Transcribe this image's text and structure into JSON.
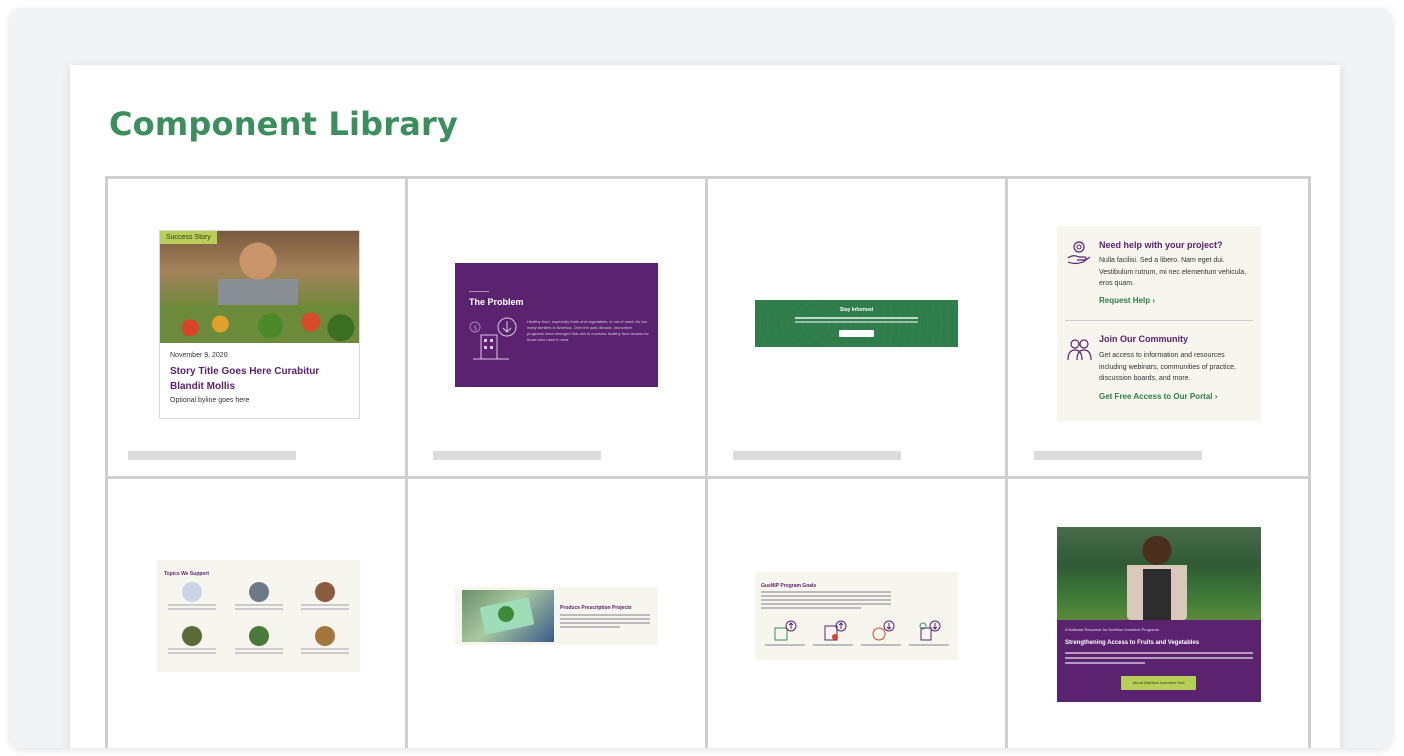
{
  "page": {
    "title": "Component Library"
  },
  "story_card": {
    "badge": "Success Story",
    "date": "November 9, 2020",
    "title": "Story Title Goes Here Curabitur Blandit Mollis",
    "byline": "Optional byline goes here"
  },
  "problem_card": {
    "title": "The Problem",
    "text": "Healthy food, especially fruits and vegetables, is out of reach for too many families in America. Over the past decade, innovative programs have emerged that aim to increase healthy food access for those who need it most."
  },
  "stay_informed": {
    "title": "Stay Informed"
  },
  "help_card": {
    "help_title": "Need help with your project?",
    "help_text": "Nulla facilisi. Sed a libero. Nam eget dui. Vestibulum rutrum, mi nec elementum vehicula, eros quam.",
    "help_link": "Request Help",
    "community_title": "Join Our Community",
    "community_text": "Get access to information and resources including webinars, communities of practice, discussion boards, and more.",
    "community_link": "Get Free Access to Our Portal"
  },
  "topics_card": {
    "title": "Topics We Support"
  },
  "rx_card": {
    "title": "Produce Prescription Projects"
  },
  "gusnip_card": {
    "title": "GusNIP Program Goals"
  },
  "hub_card": {
    "kicker": "A National Resource for Nutrition Incentive Programs",
    "title": "Strengthening Access to Fruits and Vegetables",
    "button": "About Nutrition Incentive Hub"
  },
  "colors": {
    "heading_green": "#3a8f5c",
    "brand_purple": "#5b2270",
    "brand_green": "#2f7d4b",
    "accent_lime": "#b7cf57"
  }
}
